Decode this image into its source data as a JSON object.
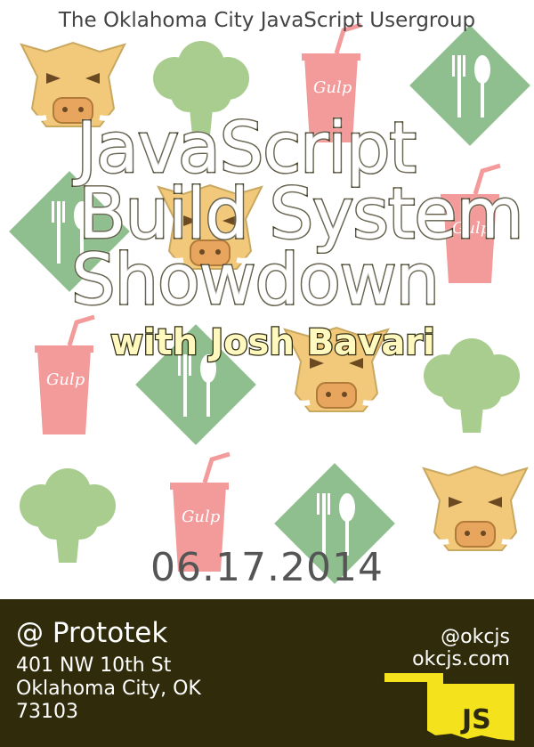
{
  "header": {
    "group_name": "The Oklahoma City JavaScript Usergroup"
  },
  "title": {
    "line1": "JavaScript",
    "line2": "Build System",
    "line3": "Showdown"
  },
  "subtitle": "with Josh Bavari",
  "date": "06.17.2014",
  "footer": {
    "venue": "@ Prototek",
    "address_line1": "401 NW 10th St",
    "address_line2": "Oklahoma City, OK",
    "address_line3": "73103",
    "twitter": "@okcjs",
    "website": "okcjs.com",
    "logo_text": "JS"
  },
  "background_icons": {
    "logo_text": "Gulp",
    "icons": [
      "boar-icon",
      "broccoli-icon",
      "gulp-cup-icon",
      "fork-knife-icon"
    ]
  },
  "colors": {
    "footer_bg": "#302c0b",
    "boar": "#f2c87a",
    "broccoli": "#a9cc8f",
    "cup": "#f39b9b",
    "diamond": "#8fbf8f",
    "state_yellow": "#f4e21c"
  }
}
